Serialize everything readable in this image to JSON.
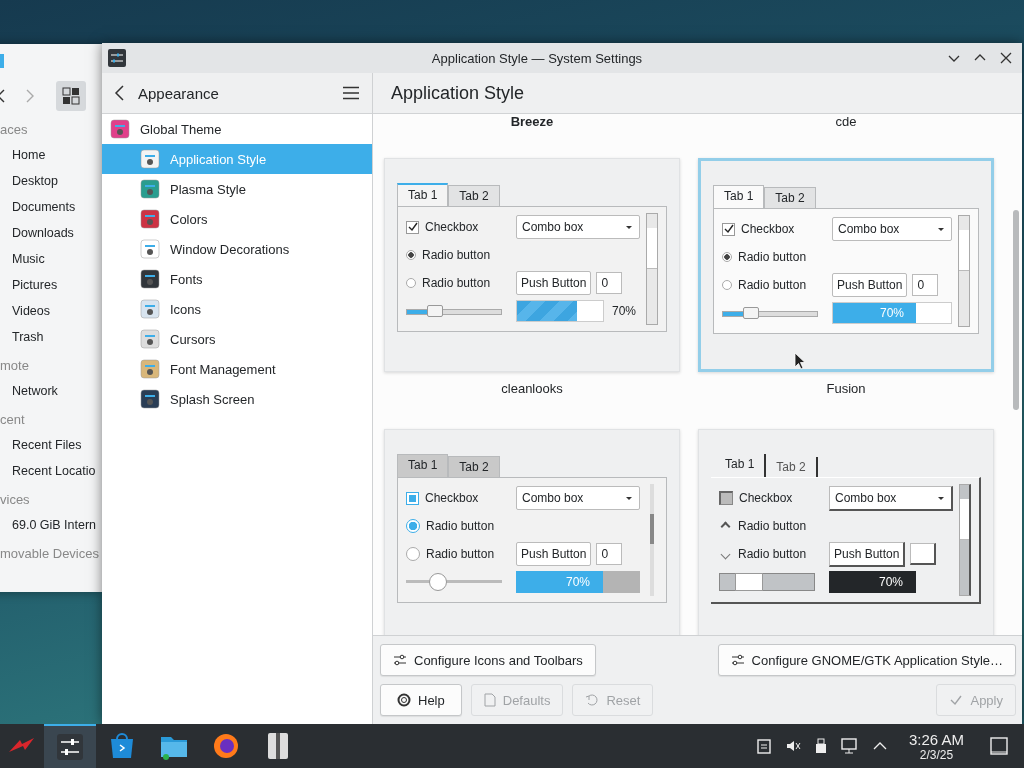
{
  "file_manager": {
    "sections": [
      {
        "header": "aces",
        "items": [
          "Home",
          "Desktop",
          "Documents",
          "Downloads",
          "Music",
          "Pictures",
          "Videos",
          "Trash"
        ]
      },
      {
        "header": "mote",
        "items": [
          "Network"
        ]
      },
      {
        "header": "cent",
        "items": [
          "Recent Files",
          "Recent Locatio"
        ]
      },
      {
        "header": "vices",
        "items": [
          "69.0 GiB Intern"
        ]
      },
      {
        "header": "movable Devices"
      }
    ]
  },
  "window": {
    "title": "Application Style — System Settings"
  },
  "sidebar": {
    "title": "Appearance",
    "items": [
      {
        "label": "Global Theme",
        "selected": false,
        "children": [
          {
            "label": "Application Style",
            "selected": true
          },
          {
            "label": "Plasma Style",
            "selected": false
          },
          {
            "label": "Colors",
            "selected": false
          },
          {
            "label": "Window Decorations",
            "selected": false
          },
          {
            "label": "Fonts",
            "selected": false
          },
          {
            "label": "Icons",
            "selected": false
          },
          {
            "label": "Cursors",
            "selected": false
          },
          {
            "label": "Font Management",
            "selected": false
          },
          {
            "label": "Splash Screen",
            "selected": false
          }
        ]
      }
    ]
  },
  "page": {
    "title": "Application Style",
    "captions_top": [
      {
        "text": "Breeze",
        "current": true
      },
      {
        "text": "cde",
        "current": false
      }
    ],
    "styles": [
      {
        "name": "cleanlooks",
        "kind": "cleanlooks",
        "selected": false,
        "preview": {
          "tabs": [
            {
              "label": "Tab 1",
              "selected": true
            },
            {
              "label": "Tab 2",
              "selected": false
            }
          ],
          "checkbox": {
            "label": "Checkbox",
            "checked": true
          },
          "radios": [
            {
              "label": "Radio button",
              "selected": true
            },
            {
              "label": "Radio button",
              "selected": false
            }
          ],
          "combo": "Combo box",
          "button": "Push Button",
          "spin": "0",
          "slider": {
            "level": 0.3
          },
          "progress": {
            "level": 0.7,
            "text": "70%"
          }
        }
      },
      {
        "name": "Fusion",
        "kind": "fusion",
        "selected": true,
        "preview": {
          "tabs": [
            {
              "label": "Tab 1",
              "selected": true
            },
            {
              "label": "Tab 2",
              "selected": false
            }
          ],
          "checkbox": {
            "label": "Checkbox",
            "checked": true
          },
          "radios": [
            {
              "label": "Radio button",
              "selected": true
            },
            {
              "label": "Radio button",
              "selected": false
            }
          ],
          "combo": "Combo box",
          "button": "Push Button",
          "spin": "0",
          "slider": {
            "level": 0.3
          },
          "progress": {
            "level": 0.7,
            "text": "70%"
          }
        }
      },
      {
        "kind": "breeze",
        "selected": false,
        "preview": {
          "tabs": [
            {
              "label": "Tab 1",
              "selected": true
            },
            {
              "label": "Tab 2",
              "selected": false
            }
          ],
          "checkbox": {
            "label": "Checkbox",
            "checked": true
          },
          "radios": [
            {
              "label": "Radio button",
              "selected": true
            },
            {
              "label": "Radio button",
              "selected": false
            }
          ],
          "combo": "Combo box",
          "button": "Push Button",
          "spin": "0",
          "slider": {
            "level": 0.32
          },
          "progress": {
            "level": 0.7,
            "text": "70%"
          }
        }
      },
      {
        "kind": "motif",
        "selected": false,
        "preview": {
          "tabs": [
            {
              "label": "Tab 1",
              "selected": true
            },
            {
              "label": "Tab 2",
              "selected": false
            }
          ],
          "checkbox": {
            "label": "Checkbox",
            "checked": true
          },
          "radios": [
            {
              "label": "Radio button",
              "selected": true
            },
            {
              "label": "Radio button",
              "selected": false
            }
          ],
          "combo": "Combo box",
          "button": "Push Button",
          "slider": {
            "level": 0.25
          },
          "progress": {
            "level": 0.7,
            "text": "70%"
          }
        }
      }
    ]
  },
  "footer": {
    "top_buttons": [
      {
        "label": "Configure Icons and Toolbars",
        "disabled": false
      },
      {
        "label": "Configure GNOME/GTK Application Style…",
        "disabled": false
      }
    ],
    "bottom_buttons": [
      {
        "label": "Help",
        "disabled": false
      },
      {
        "label": "Defaults",
        "disabled": true
      },
      {
        "label": "Reset",
        "disabled": true
      },
      {
        "label": "Apply",
        "disabled": true
      }
    ]
  },
  "taskbar": {
    "apps": [
      {
        "active": false
      },
      {
        "active": true
      },
      {
        "active": false
      },
      {
        "active": false
      },
      {
        "active": false
      },
      {
        "active": false
      }
    ],
    "clock": {
      "time": "3:26 AM",
      "date": "2/3/25"
    }
  }
}
